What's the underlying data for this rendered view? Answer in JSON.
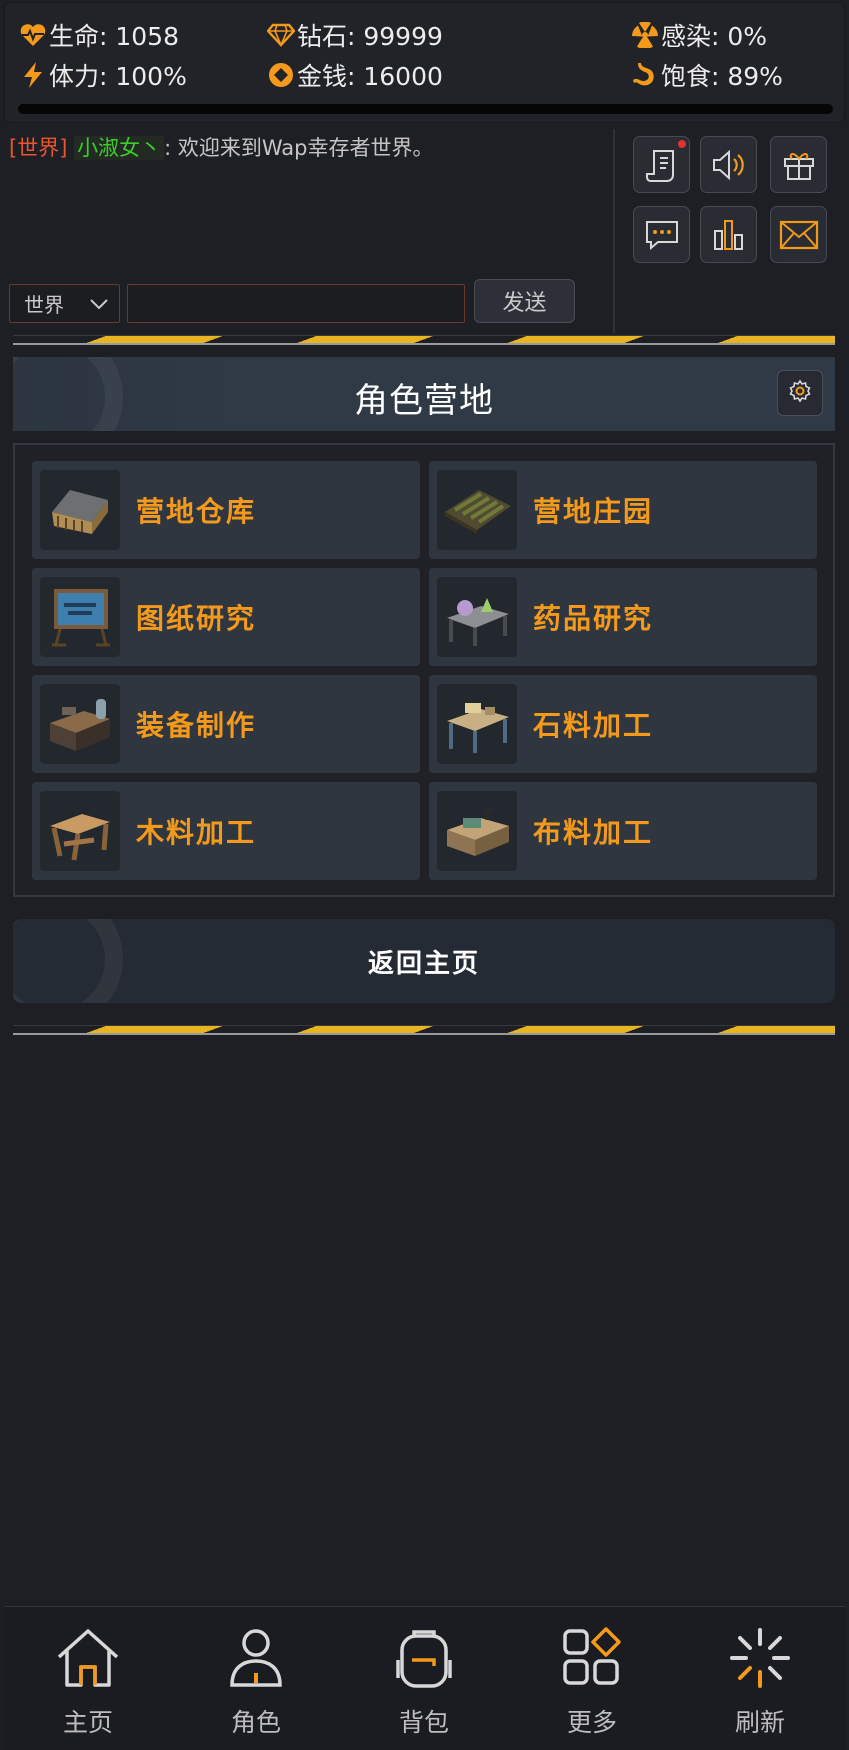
{
  "status": {
    "life": "生命: 1058",
    "diamond": "钻石: 99999",
    "infection": "感染: 0%",
    "stamina": "体力: 100%",
    "money": "金钱: 16000",
    "satiety": "饱食: 89%"
  },
  "chat": {
    "channel_tag": "[世界]",
    "username": "小淑女丶",
    "message": ": 欢迎来到Wap幸存者世界。",
    "select_value": "世界",
    "input_value": "",
    "send_label": "发送"
  },
  "tools": [
    "scroll-icon",
    "speaker-icon",
    "gift-icon",
    "chat-icon",
    "ranking-icon",
    "mail-icon"
  ],
  "page": {
    "title": "角色营地"
  },
  "cards": [
    {
      "label": "营地仓库",
      "icon": "warehouse-icon"
    },
    {
      "label": "营地庄园",
      "icon": "farm-icon"
    },
    {
      "label": "图纸研究",
      "icon": "blueprint-icon"
    },
    {
      "label": "药品研究",
      "icon": "medicine-lab-icon"
    },
    {
      "label": "装备制作",
      "icon": "equipment-bench-icon"
    },
    {
      "label": "石料加工",
      "icon": "stone-bench-icon"
    },
    {
      "label": "木料加工",
      "icon": "wood-bench-icon"
    },
    {
      "label": "布料加工",
      "icon": "cloth-bench-icon"
    }
  ],
  "back_label": "返回主页",
  "nav": [
    {
      "label": "主页",
      "icon": "home-icon"
    },
    {
      "label": "角色",
      "icon": "character-icon"
    },
    {
      "label": "背包",
      "icon": "backpack-icon"
    },
    {
      "label": "更多",
      "icon": "more-icon"
    },
    {
      "label": "刷新",
      "icon": "refresh-icon"
    }
  ],
  "colors": {
    "accent_orange": "#f39a1c",
    "hazard_yellow": "#e8b422",
    "chat_channel": "#e8552e",
    "chat_user": "#3ccd2c",
    "background": "#1d1f24"
  }
}
